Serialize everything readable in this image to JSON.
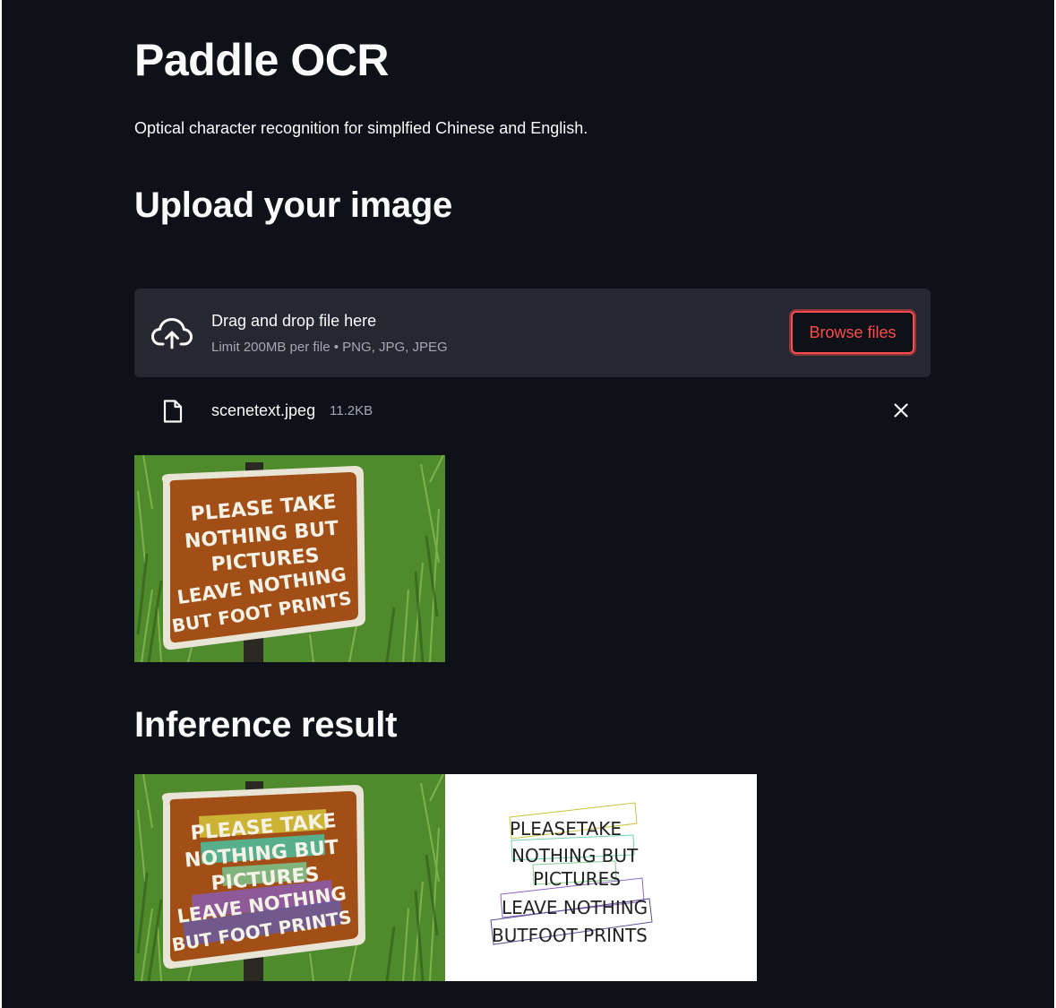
{
  "header": {
    "title": "Paddle OCR",
    "subtitle": "Optical character recognition for simplfied Chinese and English."
  },
  "upload": {
    "heading": "Upload your image",
    "drop_text": "Drag and drop file here",
    "limit_text": "Limit 200MB per file • PNG, JPG, JPEG",
    "browse_label": "Browse files",
    "upload_icon": "cloud-upload-icon"
  },
  "file": {
    "name": "scenetext.jpeg",
    "size": "11.2KB",
    "icon": "file-icon",
    "remove_icon": "close-icon"
  },
  "sign": {
    "lines": [
      "PLEASE TAKE",
      "NOTHING BUT",
      "PICTURES",
      "LEAVE NOTHING",
      "BUT FOOT PRINTS"
    ]
  },
  "result": {
    "heading": "Inference result",
    "recognized_lines": [
      "PLEASETAKE",
      "NOTHING BUT",
      "PICTURES",
      "LEAVE NOTHING",
      "BUTFOOT PRINTS"
    ]
  },
  "colors": {
    "background": "#0e1117",
    "panel": "#262730",
    "accent": "#ff4b4b",
    "text": "#fafafa",
    "muted": "#a3a8b8"
  }
}
